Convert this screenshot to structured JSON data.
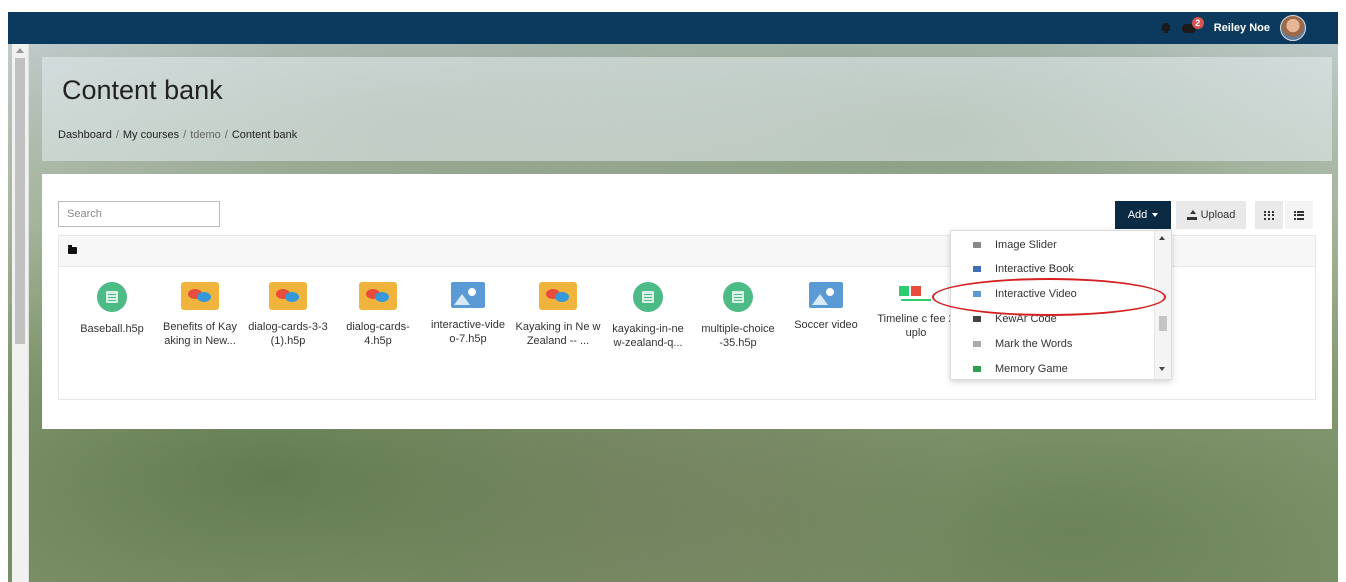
{
  "topbar": {
    "notification_count": "2",
    "username": "Reiley Noe"
  },
  "header": {
    "title": "Content bank",
    "breadcrumb": [
      {
        "label": "Dashboard"
      },
      {
        "label": "My courses"
      },
      {
        "label": "tdemo"
      },
      {
        "label": "Content bank"
      }
    ]
  },
  "toolbar": {
    "search_placeholder": "Search",
    "add_label": "Add",
    "upload_label": "Upload"
  },
  "files": [
    {
      "name": "Baseball.h5p",
      "icon": "doc-icon"
    },
    {
      "name": "Benefits of Kay aking in New...",
      "icon": "dialog-cards-icon"
    },
    {
      "name": "dialog-cards-3-3 (1).h5p",
      "icon": "dialog-cards-icon"
    },
    {
      "name": "dialog-cards-4.h5p",
      "icon": "dialog-cards-icon"
    },
    {
      "name": "interactive-vide o-7.h5p",
      "icon": "interactive-video-icon"
    },
    {
      "name": "Kayaking in Ne w Zealand -- ...",
      "icon": "dialog-cards-icon"
    },
    {
      "name": "kayaking-in-ne w-zealand-q...",
      "icon": "doc-icon"
    },
    {
      "name": "multiple-choice -35.h5p",
      "icon": "doc-icon"
    },
    {
      "name": "Soccer video",
      "icon": "interactive-video-icon"
    },
    {
      "name": "Timeline c fee 2 uplo",
      "icon": "timeline-icon"
    }
  ],
  "add_menu": {
    "items": [
      {
        "label": "Image Slider",
        "color": "#888888"
      },
      {
        "label": "Interactive Book",
        "color": "#3f6fb5"
      },
      {
        "label": "Interactive Video",
        "color": "#5b9bd5"
      },
      {
        "label": "KewAr Code",
        "color": "#444444"
      },
      {
        "label": "Mark the Words",
        "color": "#aaaaaa"
      },
      {
        "label": "Memory Game",
        "color": "#2e9e4f"
      }
    ],
    "highlighted": "Interactive Video",
    "highlight_color": "#d42020"
  }
}
